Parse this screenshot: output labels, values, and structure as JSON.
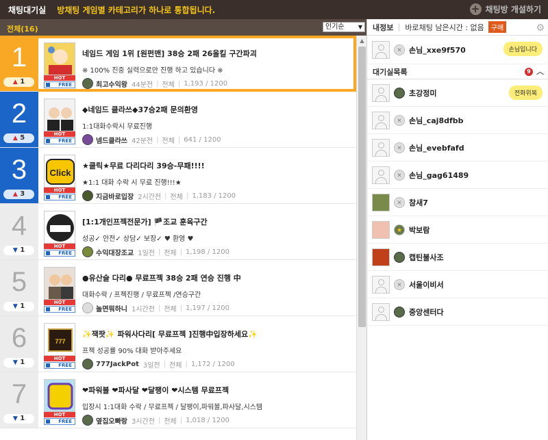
{
  "topbar": {
    "title": "채팅대기실",
    "notice": "방채팅 게임별 카테고리가 하나로 통합됩니다.",
    "create_label": "채팅방 개설하기",
    "create_icon": "plus-icon"
  },
  "list_header": {
    "all_label": "전체(16)",
    "sort_value": "인기순"
  },
  "rooms": [
    {
      "rank": "1",
      "change": "1",
      "direction": "up",
      "title": "네임드 게임 1위 [원펀맨] 38승 2패 26올킬 구간파괴",
      "desc": "※ 100% 진중 실력으로만 진행 하고 있습니다 ※",
      "host": "최고수익왕",
      "time": "44분전",
      "category": "전체",
      "count": "1,193 / 1200",
      "hot": "HOT",
      "free": "FREE"
    },
    {
      "rank": "2",
      "change": "5",
      "direction": "up",
      "title": "◆네임드 클라쓰◆37승2패 문의환영",
      "desc": "1:1대화수락시 무료진행",
      "host": "넴드클라쓰",
      "time": "42분전",
      "category": "전체",
      "count": "641 / 1200",
      "hot": "HOT",
      "free": "FREE"
    },
    {
      "rank": "3",
      "change": "3",
      "direction": "up",
      "title": "★클릭★무료 다리다리 39승-무패!!!!",
      "desc": "★1:1 대화 수락 시 무료 진행!!!★",
      "host": "지금바로입장",
      "time": "2시간전",
      "category": "전체",
      "count": "1,183 / 1200",
      "hot": "HOT",
      "free": "FREE"
    },
    {
      "rank": "4",
      "change": "1",
      "direction": "down",
      "title": "[1:1개인프젝전문가] 🏴조교 훈육구간",
      "desc": "성공✓ 안전✓ 상담✓ 보장✓ ♥ 환영 ♥",
      "host": "수익대장조교",
      "time": "1일전",
      "category": "전체",
      "count": "1,198 / 1200",
      "hot": "HOT",
      "free": "FREE"
    },
    {
      "rank": "5",
      "change": "1",
      "direction": "down",
      "title": "●유산슬 다리● 무료프젝 38승 2패 연승 진행 中",
      "desc": "대화수락 / 프젝진행 / 무료프젝 /연승구간",
      "host": "놀면뭐하니",
      "time": "1시간전",
      "category": "전체",
      "count": "1,197 / 1200",
      "hot": "HOT",
      "free": "FREE"
    },
    {
      "rank": "6",
      "change": "1",
      "direction": "down",
      "title": "✨잭팟✨ 파워사다리[ 무료프젝 ]진행中입장하세요✨",
      "desc": "프젝 성공률 90% 대화 받아주세요",
      "host": "777JackPot",
      "time": "3일전",
      "category": "전체",
      "count": "1,172 / 1200",
      "hot": "HOT",
      "free": "FREE"
    },
    {
      "rank": "7",
      "change": "1",
      "direction": "down",
      "title": "❤파워볼 ❤파사달 ❤달팽이 ❤시스템 무료프젝",
      "desc": "입장시 1:1대화 수락 / 무료프젝 / 달팽이,파워볼,파사달,시스템",
      "host": "옆집오빠랑",
      "time": "3시간전",
      "category": "전체",
      "count": "1,018 / 1200",
      "hot": "HOT",
      "free": "FREE"
    }
  ],
  "right": {
    "mine_label": "내정보",
    "remain_label": "바로채팅 남은시간 : 없음",
    "buy_label": "구매",
    "me": {
      "name": "손님_xxe9f570",
      "bubble": "손님입니다"
    },
    "wait_label": "대기실목록",
    "wait_count": "9",
    "users": [
      {
        "name": "초강정미",
        "bubble": "전화위복",
        "badge": "army"
      },
      {
        "name": "손님_caj8dfbb",
        "bubble": "",
        "badge": "x"
      },
      {
        "name": "손님_evebfafd",
        "bubble": "",
        "badge": "x"
      },
      {
        "name": "손님_gag61489",
        "bubble": "",
        "badge": "x"
      },
      {
        "name": "참새7",
        "bubble": "",
        "badge": "x"
      },
      {
        "name": "박보람",
        "bubble": "",
        "badge": "star"
      },
      {
        "name": "캡틴불사조",
        "bubble": "",
        "badge": "army"
      },
      {
        "name": "서울이비서",
        "bubble": "",
        "badge": "x"
      },
      {
        "name": "중앙센터다",
        "bubble": "",
        "badge": "army"
      }
    ]
  }
}
